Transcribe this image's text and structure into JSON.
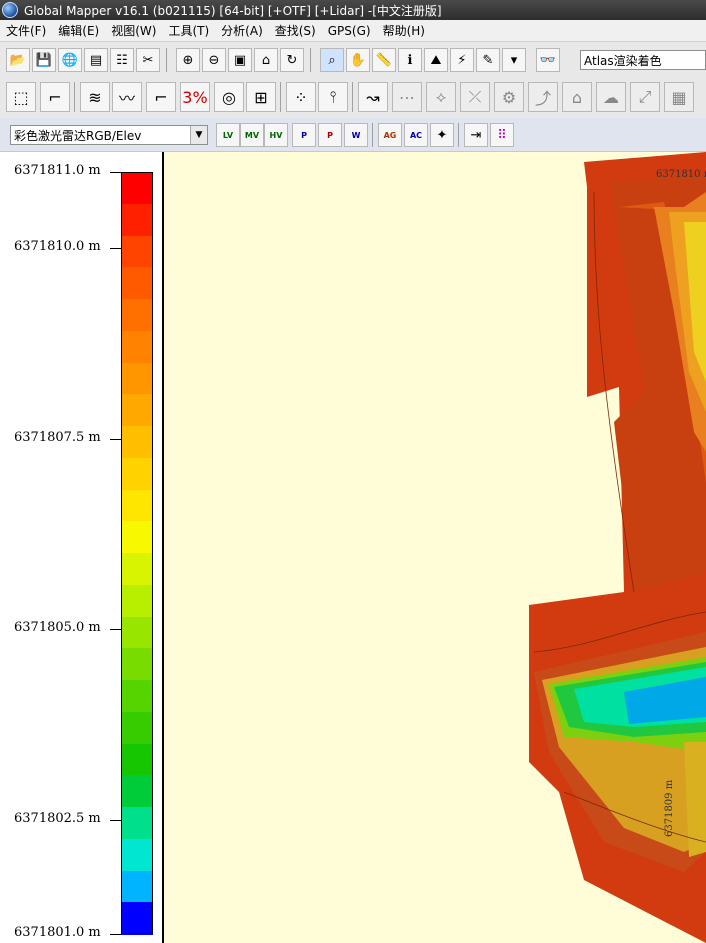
{
  "window": {
    "title": "Global Mapper v16.1 (b021115) [64-bit] [+OTF] [+Lidar] -[中文注册版]"
  },
  "menu": [
    "文件(F)",
    "编辑(E)",
    "视图(W)",
    "工具(T)",
    "分析(A)",
    "查找(S)",
    "GPS(G)",
    "帮助(H)"
  ],
  "toolbar": {
    "shader_select": "Atlas渲染着色",
    "lidar_select": "彩色激光雷达RGB/Elev",
    "lidar_buttons": [
      "LV",
      "MV",
      "HV",
      "P",
      "P",
      "W",
      "AG",
      "AC"
    ]
  },
  "legend": {
    "labels": [
      "6371811.0 m",
      "6371810.0 m",
      "6371807.5 m",
      "6371805.0 m",
      "6371802.5 m",
      "6371801.0 m"
    ],
    "colors": [
      "#ff0000",
      "#ff2000",
      "#ff4400",
      "#ff5a00",
      "#ff7000",
      "#ff8200",
      "#ff9600",
      "#ffa800",
      "#ffbe00",
      "#ffd200",
      "#ffe600",
      "#f8f800",
      "#d8f400",
      "#b8ee00",
      "#98e600",
      "#78dc00",
      "#56d400",
      "#36cc00",
      "#16c600",
      "#00cc3a",
      "#00e08c",
      "#00e6d0",
      "#00b4ff",
      "#0000ff"
    ]
  },
  "map": {
    "contour_labels": [
      "6371810 m",
      "6371809 m"
    ]
  }
}
